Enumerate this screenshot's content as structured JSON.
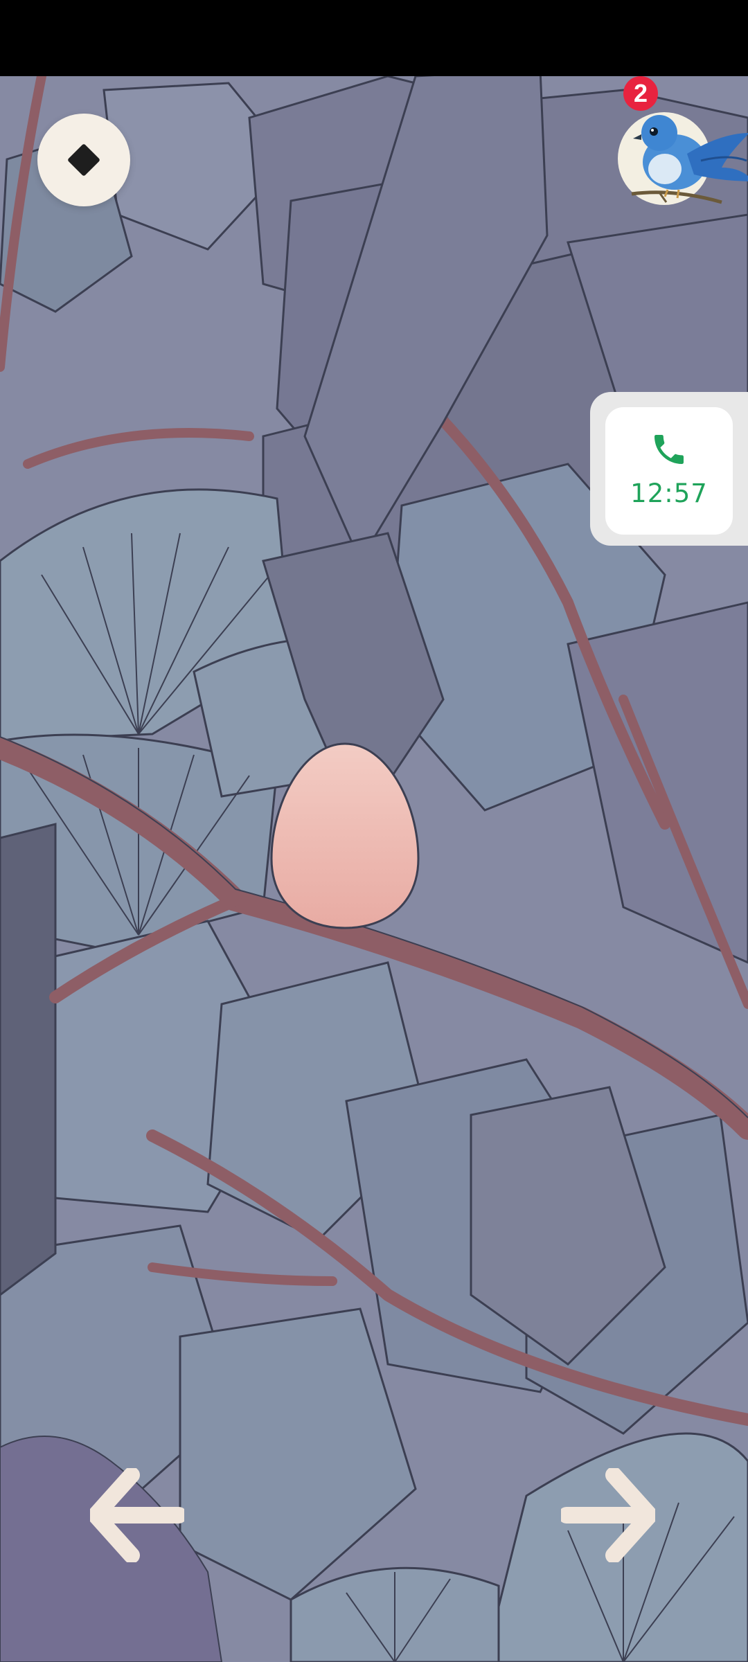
{
  "status_bar": {},
  "menu_button": {
    "icon": "diamond-icon"
  },
  "bird_button": {
    "icon": "blue-bird-icon",
    "badge_count": "2"
  },
  "call_card": {
    "icon": "phone-icon",
    "time": "12:57",
    "accent": "#1fa35a"
  },
  "navigation": {
    "left_icon": "arrow-left-icon",
    "right_icon": "arrow-right-icon"
  },
  "scene": {
    "object": "egg",
    "egg_color": "#f0b9b1"
  }
}
